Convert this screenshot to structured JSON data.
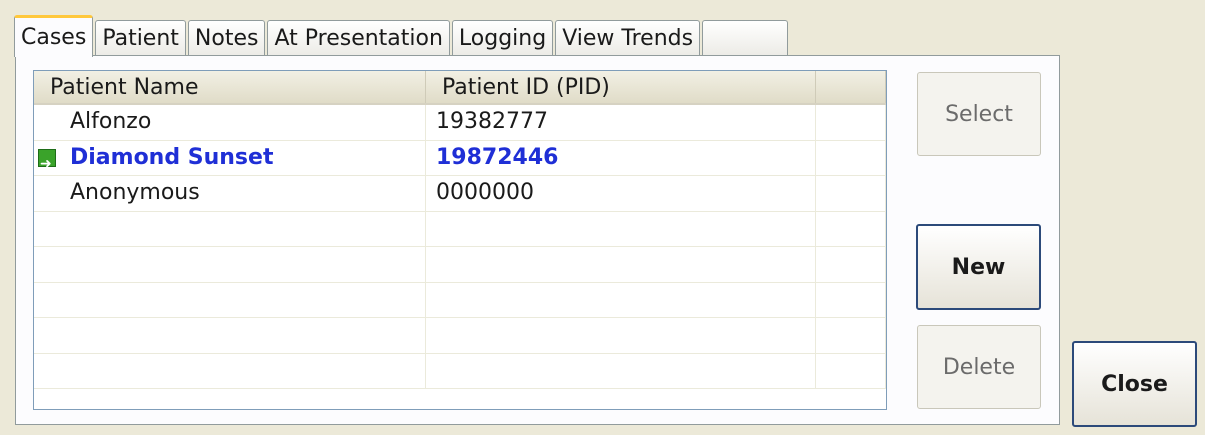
{
  "tabs": [
    {
      "label": "Cases"
    },
    {
      "label": "Patient"
    },
    {
      "label": "Notes"
    },
    {
      "label": "At Presentation"
    },
    {
      "label": "Logging"
    },
    {
      "label": "View Trends"
    },
    {
      "label": ""
    }
  ],
  "table": {
    "headers": [
      "Patient Name",
      "Patient ID (PID)",
      ""
    ],
    "rows": [
      {
        "name": "Alfonzo",
        "pid": "19382777"
      },
      {
        "name": "Diamond Sunset",
        "pid": "19872446"
      },
      {
        "name": "Anonymous",
        "pid": "0000000"
      },
      {
        "name": "",
        "pid": ""
      },
      {
        "name": "",
        "pid": ""
      },
      {
        "name": "",
        "pid": ""
      },
      {
        "name": "",
        "pid": ""
      },
      {
        "name": "",
        "pid": ""
      }
    ],
    "selected_row_icon": "green-arrow-icon"
  },
  "buttons": {
    "select": "Select",
    "new": "New",
    "delete": "Delete",
    "close": "Close"
  }
}
